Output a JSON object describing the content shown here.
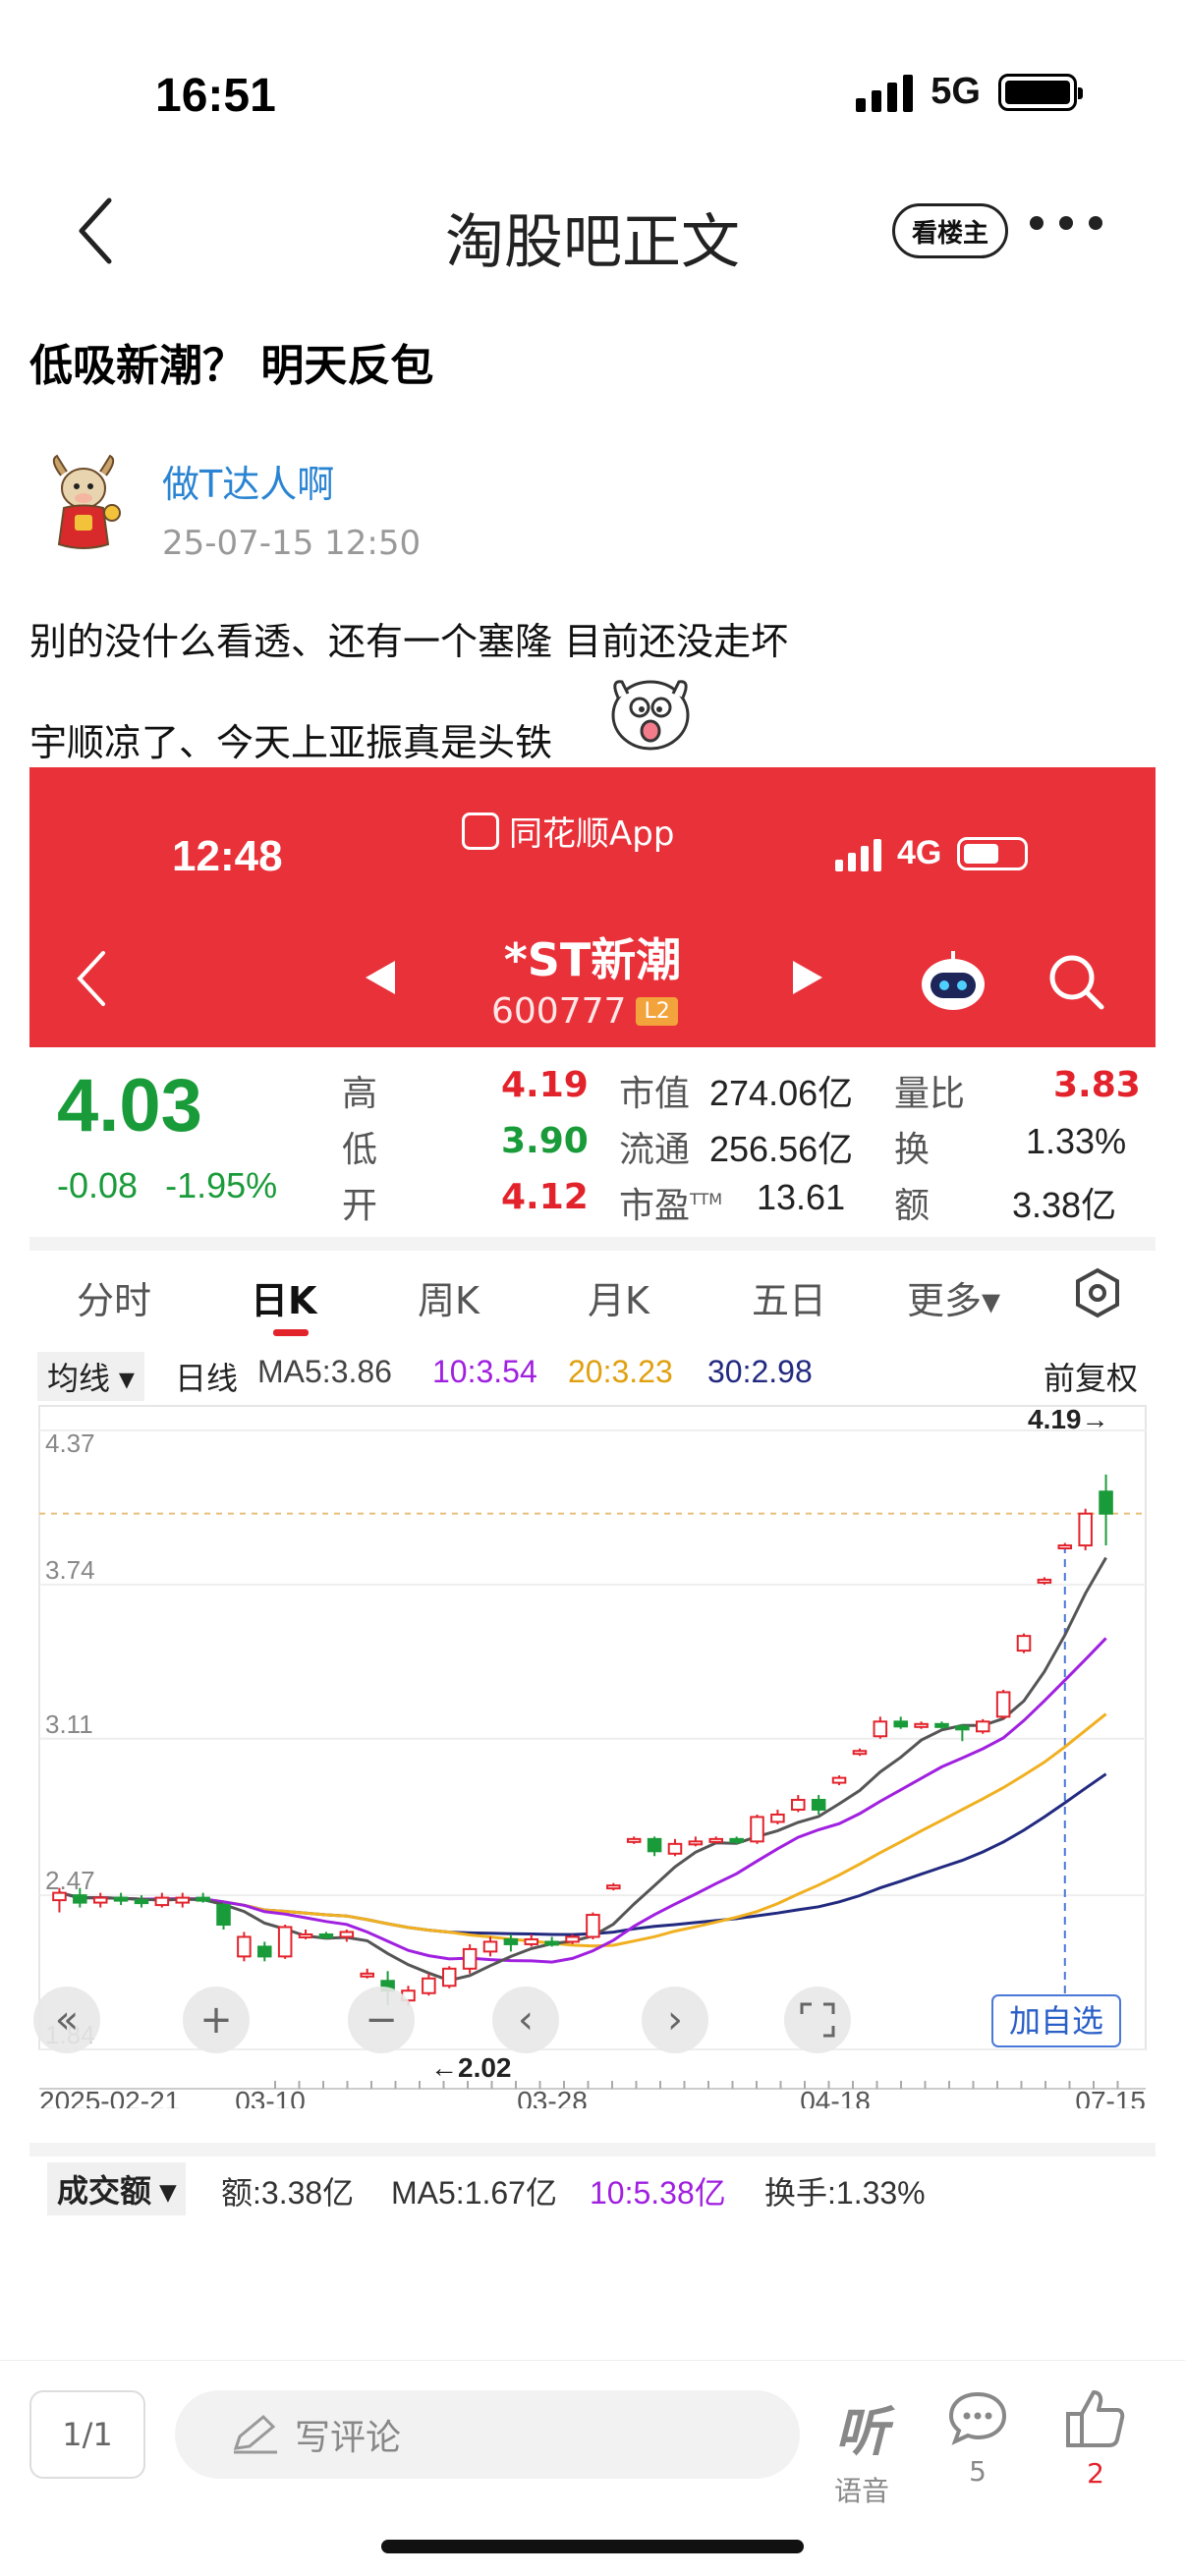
{
  "status_bar": {
    "time": "16:51",
    "network": "5G"
  },
  "nav": {
    "title": "淘股吧正文",
    "op_only_label": "看楼主"
  },
  "post": {
    "title": "低吸新潮？ 明天反包",
    "author": "做T达人啊",
    "time": "25-07-15 12:50",
    "lines": [
      "别的没什么看透、还有一个塞隆 目前还没走坏",
      "宇顺凉了、今天上亚振真是头铁"
    ]
  },
  "embedded_screenshot": {
    "status_time": "12:48",
    "app_name": "同花顺App",
    "network": "4G",
    "stock_name": "*ST新潮",
    "stock_code": "600777",
    "level_badge": "L2",
    "quote": {
      "price": "4.03",
      "change": "-0.08",
      "change_pct": "-1.95%",
      "high_label": "高",
      "high": "4.19",
      "low_label": "低",
      "low": "3.90",
      "open_label": "开",
      "open": "4.12",
      "mcap_label": "市值",
      "mcap": "274.06亿",
      "float_label": "流通",
      "float": "256.56亿",
      "pe_label": "市盈",
      "pe_sup": "TTM",
      "pe": "13.61",
      "vol_ratio_label": "量比",
      "vol_ratio": "3.83",
      "turnover_label": "换",
      "turnover": "1.33%",
      "amount_label": "额",
      "amount": "3.38亿"
    },
    "tabs": [
      "分时",
      "日K",
      "周K",
      "月K",
      "五日",
      "更多▾"
    ],
    "active_tab": "日K",
    "ma_legend": {
      "selector": "均线 ▾",
      "period": "日线",
      "ma5": "MA5:3.86",
      "ma10": "10:3.54",
      "ma20": "20:3.23",
      "ma30": "30:2.98",
      "adjust": "前复权"
    },
    "add_watch_label": "加自选",
    "volume_bar": {
      "selector": "成交额 ▾",
      "amount": "额:3.38亿",
      "ma5": "MA5:1.67亿",
      "ma10": "10:5.38亿",
      "turnover": "换手:1.33%"
    }
  },
  "chart_data": {
    "type": "candlestick",
    "y_ticks": [
      "4.37",
      "3.74",
      "3.11",
      "2.47",
      "1.84"
    ],
    "ylim": [
      1.84,
      4.37
    ],
    "x_ticks": [
      "2025-02-21",
      "03-10",
      "03-28",
      "04-18",
      "07-15"
    ],
    "max_label": "4.19→",
    "min_label": "←2.02",
    "candles": [
      {
        "o": 2.45,
        "c": 2.48,
        "h": 2.5,
        "l": 2.4
      },
      {
        "o": 2.47,
        "c": 2.44,
        "h": 2.5,
        "l": 2.42
      },
      {
        "o": 2.44,
        "c": 2.46,
        "h": 2.48,
        "l": 2.42
      },
      {
        "o": 2.46,
        "c": 2.45,
        "h": 2.48,
        "l": 2.43
      },
      {
        "o": 2.45,
        "c": 2.44,
        "h": 2.47,
        "l": 2.42
      },
      {
        "o": 2.43,
        "c": 2.46,
        "h": 2.48,
        "l": 2.42
      },
      {
        "o": 2.44,
        "c": 2.46,
        "h": 2.48,
        "l": 2.42
      },
      {
        "o": 2.46,
        "c": 2.45,
        "h": 2.48,
        "l": 2.44
      },
      {
        "o": 2.43,
        "c": 2.35,
        "h": 2.44,
        "l": 2.33
      },
      {
        "o": 2.22,
        "c": 2.3,
        "h": 2.32,
        "l": 2.2
      },
      {
        "o": 2.26,
        "c": 2.22,
        "h": 2.28,
        "l": 2.2
      },
      {
        "o": 2.22,
        "c": 2.34,
        "h": 2.35,
        "l": 2.21
      },
      {
        "o": 2.3,
        "c": 2.31,
        "h": 2.33,
        "l": 2.29
      },
      {
        "o": 2.31,
        "c": 2.3,
        "h": 2.32,
        "l": 2.29
      },
      {
        "o": 2.3,
        "c": 2.32,
        "h": 2.33,
        "l": 2.28
      },
      {
        "o": 2.15,
        "c": 2.15,
        "h": 2.17,
        "l": 2.13
      },
      {
        "o": 2.12,
        "c": 2.08,
        "h": 2.16,
        "l": 2.02
      },
      {
        "o": 2.04,
        "c": 2.08,
        "h": 2.1,
        "l": 2.02
      },
      {
        "o": 2.07,
        "c": 2.13,
        "h": 2.15,
        "l": 2.06
      },
      {
        "o": 2.1,
        "c": 2.17,
        "h": 2.18,
        "l": 2.09
      },
      {
        "o": 2.17,
        "c": 2.25,
        "h": 2.27,
        "l": 2.15
      },
      {
        "o": 2.24,
        "c": 2.28,
        "h": 2.3,
        "l": 2.22
      },
      {
        "o": 2.29,
        "c": 2.27,
        "h": 2.31,
        "l": 2.24
      },
      {
        "o": 2.27,
        "c": 2.29,
        "h": 2.31,
        "l": 2.26
      },
      {
        "o": 2.28,
        "c": 2.27,
        "h": 2.3,
        "l": 2.26
      },
      {
        "o": 2.28,
        "c": 2.3,
        "h": 2.31,
        "l": 2.27
      },
      {
        "o": 2.3,
        "c": 2.39,
        "h": 2.4,
        "l": 2.29
      },
      {
        "o": 2.5,
        "c": 2.51,
        "h": 2.52,
        "l": 2.49
      },
      {
        "o": 2.69,
        "c": 2.7,
        "h": 2.71,
        "l": 2.68
      },
      {
        "o": 2.7,
        "c": 2.65,
        "h": 2.71,
        "l": 2.63
      },
      {
        "o": 2.64,
        "c": 2.68,
        "h": 2.7,
        "l": 2.63
      },
      {
        "o": 2.68,
        "c": 2.69,
        "h": 2.71,
        "l": 2.67
      },
      {
        "o": 2.69,
        "c": 2.7,
        "h": 2.71,
        "l": 2.68
      },
      {
        "o": 2.7,
        "c": 2.69,
        "h": 2.71,
        "l": 2.68
      },
      {
        "o": 2.69,
        "c": 2.79,
        "h": 2.8,
        "l": 2.68
      },
      {
        "o": 2.77,
        "c": 2.8,
        "h": 2.82,
        "l": 2.76
      },
      {
        "o": 2.82,
        "c": 2.86,
        "h": 2.88,
        "l": 2.81
      },
      {
        "o": 2.86,
        "c": 2.82,
        "h": 2.88,
        "l": 2.8
      },
      {
        "o": 2.93,
        "c": 2.95,
        "h": 2.96,
        "l": 2.92
      },
      {
        "o": 3.05,
        "c": 3.06,
        "h": 3.07,
        "l": 3.04
      },
      {
        "o": 3.12,
        "c": 3.18,
        "h": 3.2,
        "l": 3.11
      },
      {
        "o": 3.18,
        "c": 3.16,
        "h": 3.2,
        "l": 3.15
      },
      {
        "o": 3.16,
        "c": 3.17,
        "h": 3.18,
        "l": 3.15
      },
      {
        "o": 3.17,
        "c": 3.16,
        "h": 3.18,
        "l": 3.15
      },
      {
        "o": 3.16,
        "c": 3.15,
        "h": 3.17,
        "l": 3.1
      },
      {
        "o": 3.14,
        "c": 3.18,
        "h": 3.19,
        "l": 3.13
      },
      {
        "o": 3.2,
        "c": 3.3,
        "h": 3.31,
        "l": 3.19
      },
      {
        "o": 3.47,
        "c": 3.53,
        "h": 3.54,
        "l": 3.46
      },
      {
        "o": 3.75,
        "c": 3.76,
        "h": 3.77,
        "l": 3.74
      },
      {
        "o": 3.9,
        "c": 3.9,
        "h": 3.91,
        "l": 3.89
      },
      {
        "o": 3.9,
        "c": 4.03,
        "h": 4.05,
        "l": 3.88
      },
      {
        "o": 4.12,
        "c": 4.03,
        "h": 4.19,
        "l": 3.9
      }
    ],
    "ma": {
      "ma5": {
        "color": "#555555",
        "label": "MA5:3.86"
      },
      "ma10": {
        "color": "#a020e0",
        "label": "10:3.54"
      },
      "ma20": {
        "color": "#f0b020",
        "label": "20:3.23"
      },
      "ma30": {
        "color": "#222a80",
        "label": "30:2.98"
      }
    }
  },
  "bottom_bar": {
    "page": "1/1",
    "comment_placeholder": "写评论",
    "listen_glyph": "听",
    "listen_label": "语音",
    "comments_count": "5",
    "likes_count": "2"
  },
  "colors": {
    "up": "#e3232c",
    "down": "#1a9b3a",
    "header_red": "#e9313a",
    "link_blue": "#2a84d2"
  }
}
